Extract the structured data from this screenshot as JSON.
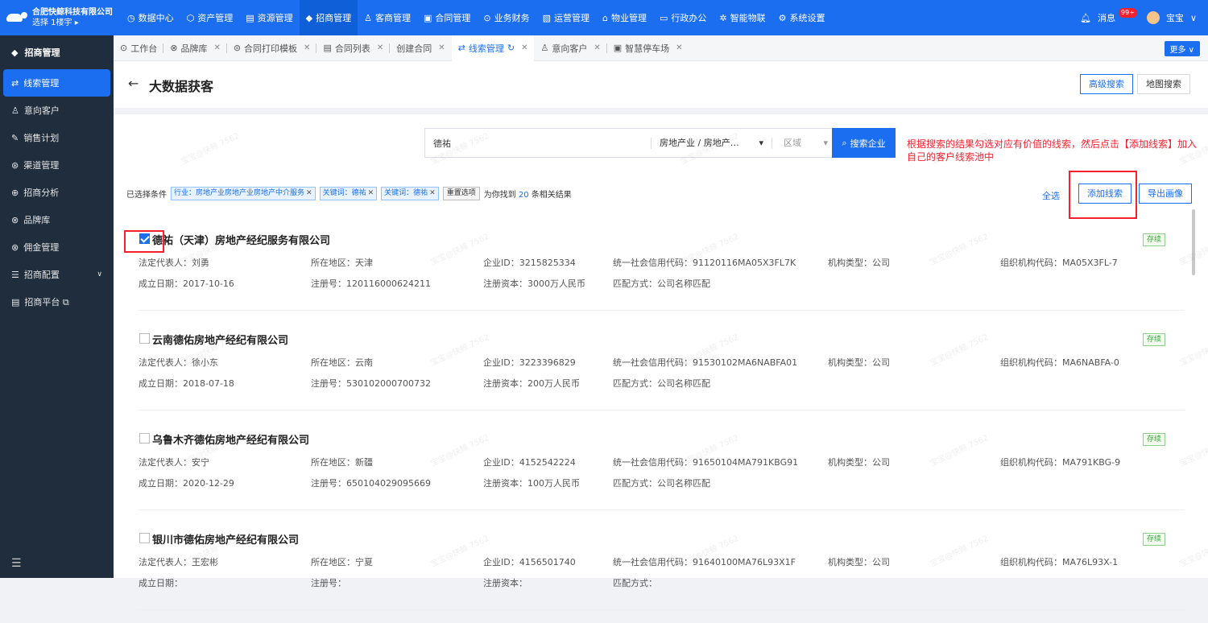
{
  "brand": {
    "company": "合肥快鲸科技有限公司",
    "location": "选择 1楼宇 ▸"
  },
  "nav": [
    {
      "icon": "◷",
      "label": "数据中心"
    },
    {
      "icon": "⬡",
      "label": "资产管理"
    },
    {
      "icon": "▤",
      "label": "资源管理"
    },
    {
      "icon": "◆",
      "label": "招商管理"
    },
    {
      "icon": "♙",
      "label": "客商管理"
    },
    {
      "icon": "▣",
      "label": "合同管理"
    },
    {
      "icon": "⊙",
      "label": "业务财务"
    },
    {
      "icon": "▧",
      "label": "运营管理"
    },
    {
      "icon": "⌂",
      "label": "物业管理"
    },
    {
      "icon": "▭",
      "label": "行政办公"
    },
    {
      "icon": "✲",
      "label": "智能物联"
    },
    {
      "icon": "⚙",
      "label": "系统设置"
    }
  ],
  "topright": {
    "messages": "消息",
    "badge": "99+",
    "user": "宝宝"
  },
  "sidebar": {
    "title": "招商管理",
    "items": [
      {
        "icon": "⇄",
        "label": "线索管理"
      },
      {
        "icon": "♙",
        "label": "意向客户"
      },
      {
        "icon": "✎",
        "label": "销售计划"
      },
      {
        "icon": "⊛",
        "label": "渠道管理"
      },
      {
        "icon": "⊕",
        "label": "招商分析"
      },
      {
        "icon": "⊗",
        "label": "品牌库"
      },
      {
        "icon": "⊗",
        "label": "佣金管理"
      },
      {
        "icon": "☰",
        "label": "招商配置"
      },
      {
        "icon": "▤",
        "label": "招商平台 ⧉"
      }
    ],
    "footer_icon": "☰"
  },
  "tabs": [
    {
      "icon": "⊙",
      "label": "工作台"
    },
    {
      "icon": "⊗",
      "label": "品牌库"
    },
    {
      "icon": "⊜",
      "label": "合同打印模板"
    },
    {
      "icon": "▤",
      "label": "合同列表"
    },
    {
      "icon": "",
      "label": "创建合同"
    },
    {
      "icon": "⇄",
      "label": "线索管理"
    },
    {
      "icon": "♙",
      "label": "意向客户"
    },
    {
      "icon": "▣",
      "label": "智慧停车场"
    }
  ],
  "more": "更多 ∨",
  "page": {
    "title": "大数据获客",
    "adv_search": "高级搜索",
    "map_search": "地图搜索"
  },
  "search": {
    "keyword": "德祐",
    "industry": "房地产业 / 房地产…",
    "area": "区域",
    "button": "搜索企业"
  },
  "hint": "根据搜索的结果勾选对应有价值的线索，然后点击【添加线索】加入自己的客户线索池中",
  "filters": {
    "label": "已选择条件",
    "tags": [
      "行业：房地产业房地产业房地产中介服务",
      "关键词：德祐",
      "关键词：德祐"
    ],
    "reset": "重置选项",
    "found_prefix": "为你找到",
    "count": "20",
    "found_suffix": "条相关结果"
  },
  "actions": {
    "select_all": "全选",
    "add": "添加线索",
    "export": "导出画像"
  },
  "field_labels": {
    "legal": "法定代表人：",
    "region": "所在地区：",
    "eid": "企业ID：",
    "credit": "统一社会信用代码：",
    "org_type": "机构类型：",
    "org_code": "组织机构代码：",
    "found_date": "成立日期：",
    "reg_no": "注册号：",
    "capital": "注册资本：",
    "match": "匹配方式："
  },
  "records": [
    {
      "checked": true,
      "name": "德祐（天津）房地产经纪服务有限公司",
      "status": "存续",
      "legal": "刘勇",
      "region": "天津",
      "eid": "3215825334",
      "credit": "91120116MA05X3FL7K",
      "org_type": "公司",
      "org_code": "MA05X3FL-7",
      "found_date": "2017-10-16",
      "reg_no": "120116000624211",
      "capital": "3000万人民币",
      "match": "公司名称匹配"
    },
    {
      "checked": false,
      "name": "云南德佑房地产经纪有限公司",
      "status": "存续",
      "legal": "徐小东",
      "region": "云南",
      "eid": "3223396829",
      "credit": "91530102MA6NABFA01",
      "org_type": "公司",
      "org_code": "MA6NABFA-0",
      "found_date": "2018-07-18",
      "reg_no": "530102000700732",
      "capital": "200万人民币",
      "match": "公司名称匹配"
    },
    {
      "checked": false,
      "name": "乌鲁木齐德佑房地产经纪有限公司",
      "status": "存续",
      "legal": "安宁",
      "region": "新疆",
      "eid": "4152542224",
      "credit": "91650104MA791KBG91",
      "org_type": "公司",
      "org_code": "MA791KBG-9",
      "found_date": "2020-12-29",
      "reg_no": "650104029095669",
      "capital": "100万人民币",
      "match": "公司名称匹配"
    },
    {
      "checked": false,
      "name": "银川市德佑房地产经纪有限公司",
      "status": "存续",
      "legal": "王宏彬",
      "region": "宁夏",
      "eid": "4156501740",
      "credit": "91640100MA76L93X1F",
      "org_type": "公司",
      "org_code": "MA76L93X-1",
      "found_date": "",
      "reg_no": "",
      "capital": "",
      "match": ""
    }
  ],
  "watermark": "宝宝@快鲸 7562"
}
